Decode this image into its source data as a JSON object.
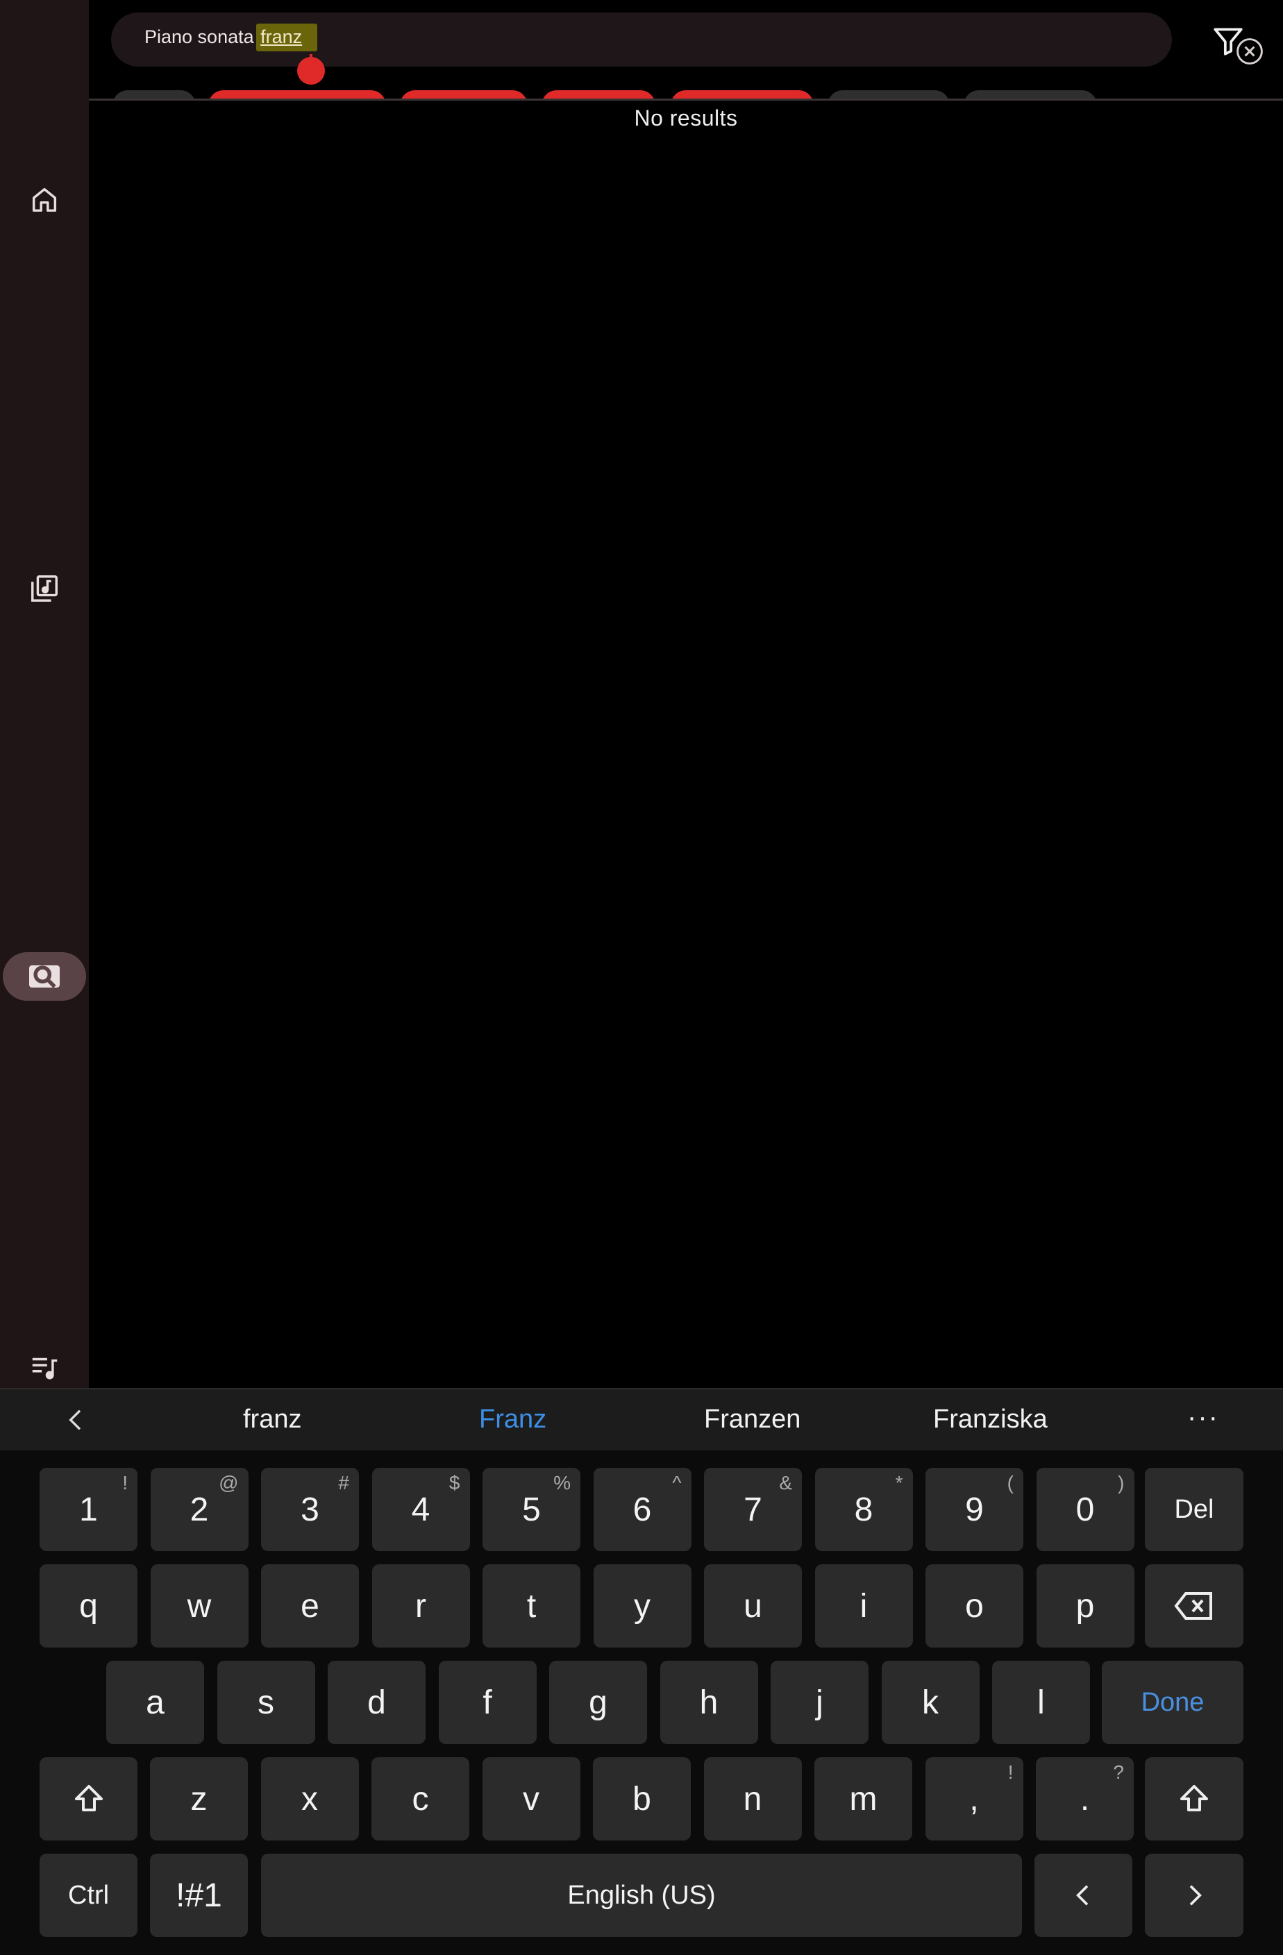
{
  "search": {
    "query_prefix": "Piano sonata ",
    "query_highlight": "franz"
  },
  "results": {
    "empty_text": "No results"
  },
  "suggestions": [
    "franz",
    "Franz",
    "Franzen",
    "Franziska"
  ],
  "suggestion_more": "···",
  "keyboard": {
    "row1": [
      {
        "k": "1",
        "a": "!"
      },
      {
        "k": "2",
        "a": "@"
      },
      {
        "k": "3",
        "a": "#"
      },
      {
        "k": "4",
        "a": "$"
      },
      {
        "k": "5",
        "a": "%"
      },
      {
        "k": "6",
        "a": "^"
      },
      {
        "k": "7",
        "a": "&"
      },
      {
        "k": "8",
        "a": "*"
      },
      {
        "k": "9",
        "a": "("
      },
      {
        "k": "0",
        "a": ")"
      }
    ],
    "del_label": "Del",
    "row2": [
      "q",
      "w",
      "e",
      "r",
      "t",
      "y",
      "u",
      "i",
      "o",
      "p"
    ],
    "row3": [
      "a",
      "s",
      "d",
      "f",
      "g",
      "h",
      "j",
      "k",
      "l"
    ],
    "done_label": "Done",
    "row4": [
      {
        "k": "z",
        "a": ""
      },
      {
        "k": "x",
        "a": ""
      },
      {
        "k": "c",
        "a": ""
      },
      {
        "k": "v",
        "a": ""
      },
      {
        "k": "b",
        "a": ""
      },
      {
        "k": "n",
        "a": ""
      },
      {
        "k": "m",
        "a": ""
      },
      {
        "k": ",",
        "a": "!"
      },
      {
        "k": ".",
        "a": "?"
      }
    ],
    "ctrl_label": "Ctrl",
    "symbols_label": "!#1",
    "space_label": "English (US)"
  },
  "colors": {
    "accent_red": "#e02a2a",
    "suggestion_highlight": "#3d8fe6",
    "done_color": "#4a90e2",
    "sidebar_bg": "#1f1416"
  }
}
